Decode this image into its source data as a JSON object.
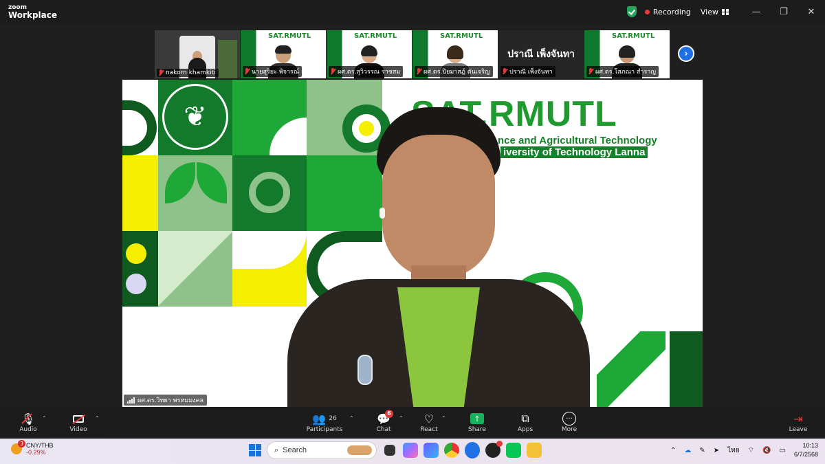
{
  "app": {
    "logo_top": "zoom",
    "logo_bottom": "Workplace"
  },
  "titlebar": {
    "recording_label": "Recording",
    "view_label": "View",
    "minimize": "—",
    "restore": "❐",
    "close": "✕"
  },
  "participants_strip": [
    {
      "name": "nakorn khamkiti",
      "style": "photo",
      "mic_muted": true
    },
    {
      "name": "นายสุริยะ พิจารณ์",
      "style": "banner",
      "mic_muted": true
    },
    {
      "name": "ผศ.ดร.สุวิวรรณ ราชสม",
      "style": "banner",
      "mic_muted": true
    },
    {
      "name": "ผศ.ดร.ปิยมาสฎ์ ตันเจริญ",
      "style": "banner",
      "mic_muted": true
    },
    {
      "name": "ปราณี เพ็งจันทา",
      "style": "text",
      "display_text": "ปราณี เพ็งจันทา",
      "mic_muted": true
    },
    {
      "name": "ผศ.ดร.โสภณา สำราญ",
      "style": "banner",
      "mic_muted": true
    }
  ],
  "thumb_banner_text": "SAT.RMUTL",
  "main_video": {
    "brand_title": "SAT.RMUTL",
    "brand_line1": "nce and Agricultural Technology",
    "brand_line2": "iversity of Technology Lanna",
    "speaker_name": "ผศ.ดร.วิทยา พรหมมงคล"
  },
  "toolbar": {
    "audio": "Audio",
    "video": "Video",
    "participants": "Participants",
    "participants_count": "26",
    "chat": "Chat",
    "chat_badge": "6",
    "react": "React",
    "share": "Share",
    "apps": "Apps",
    "more": "More",
    "leave": "Leave"
  },
  "taskbar": {
    "ticker_symbol": "CNY/THB",
    "ticker_change": "-0.29%",
    "ticker_badge": "3",
    "search_placeholder": "Search",
    "lang": "ไทย",
    "time": "10:13",
    "date": "6/7/2568"
  },
  "colors": {
    "brand_green": "#1e9a2e",
    "dark_green": "#0f5a1f",
    "yellow": "#f4ef00",
    "record_red": "#e5393a",
    "share_green": "#18b05b"
  }
}
